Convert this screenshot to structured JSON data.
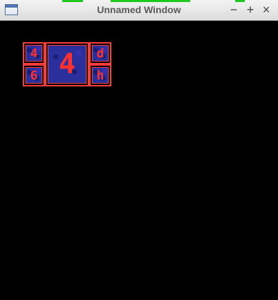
{
  "window": {
    "title": "Unnamed Window",
    "minimize_label": "−",
    "maximize_label": "+",
    "close_label": "×",
    "icon": "window-app-icon"
  },
  "tiles": [
    {
      "name": "tile-top-left",
      "glyph": "4"
    },
    {
      "name": "tile-center-large",
      "glyph": "4"
    },
    {
      "name": "tile-top-right",
      "glyph": "d"
    },
    {
      "name": "tile-bottom-left",
      "glyph": "6"
    },
    {
      "name": "tile-bottom-right",
      "glyph": "h"
    }
  ],
  "colors": {
    "background": "#000000",
    "tile_border": "#ff3b3b",
    "tile_fill": "#2b2f9c",
    "glyph": "#ff3030",
    "green_strip": "#1ec81e"
  }
}
